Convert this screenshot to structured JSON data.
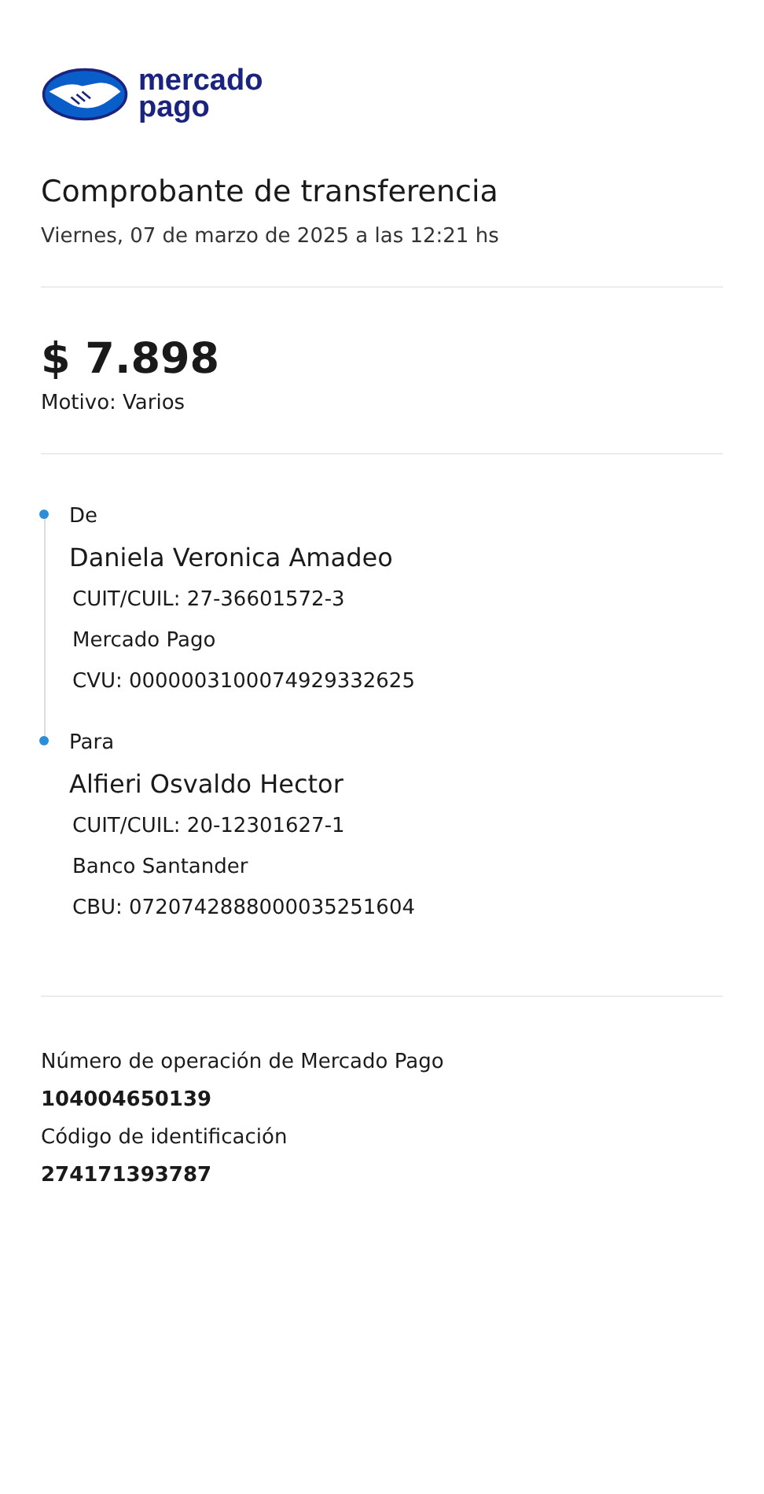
{
  "logo": {
    "line_1": "mercado",
    "line_2": "pago"
  },
  "header": {
    "title": "Comprobante de transferencia",
    "date": "Viernes, 07 de marzo de 2025 a las 12:21 hs"
  },
  "amount": {
    "value": "$ 7.898",
    "reason": "Motivo: Varios"
  },
  "parties": [
    {
      "label": "De",
      "name": "Daniela Veronica Amadeo",
      "details": [
        "CUIT/CUIL: 27-36601572-3",
        "Mercado Pago",
        "CVU: 0000003100074929332625"
      ]
    },
    {
      "label": "Para",
      "name": "Alfieri Osvaldo Hector",
      "details": [
        "CUIT/CUIL: 20-12301627-1",
        "Banco Santander",
        "CBU: 0720742888000035251604"
      ]
    }
  ],
  "references": [
    {
      "label": "Número de operación de Mercado Pago",
      "value": "104004650139"
    },
    {
      "label": "Código de identificación",
      "value": "274171393787"
    }
  ]
}
